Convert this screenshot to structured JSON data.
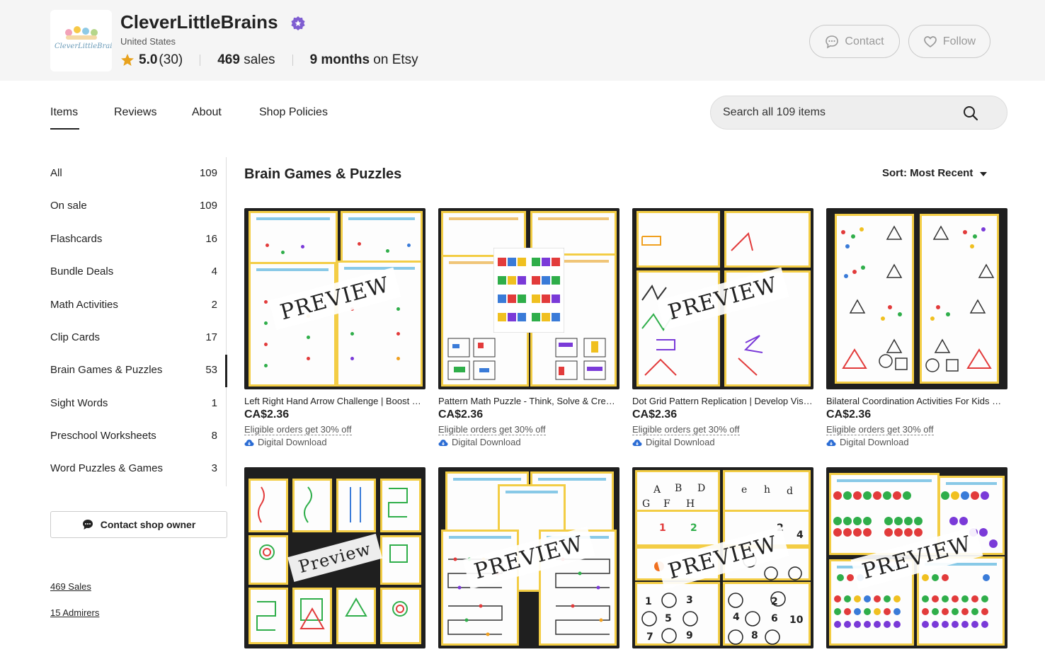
{
  "shop": {
    "name": "CleverLittleBrains",
    "logo_text": "CleverLittleBrains",
    "location": "United States",
    "rating": "5.0",
    "review_count": "(30)",
    "sales_number": "469",
    "sales_word": "sales",
    "age_number": "9 months",
    "age_suffix": "on Etsy",
    "contact_label": "Contact",
    "follow_label": "Follow"
  },
  "tabs": [
    {
      "label": "Items",
      "active": true
    },
    {
      "label": "Reviews"
    },
    {
      "label": "About"
    },
    {
      "label": "Shop Policies"
    }
  ],
  "search": {
    "placeholder": "Search all 109 items"
  },
  "sidebar": {
    "categories": [
      {
        "label": "All",
        "count": "109"
      },
      {
        "label": "On sale",
        "count": "109"
      },
      {
        "label": "Flashcards",
        "count": "16"
      },
      {
        "label": "Bundle Deals",
        "count": "4"
      },
      {
        "label": "Math Activities",
        "count": "2"
      },
      {
        "label": "Clip Cards",
        "count": "17"
      },
      {
        "label": "Brain Games & Puzzles",
        "count": "53",
        "active": true
      },
      {
        "label": "Sight Words",
        "count": "1"
      },
      {
        "label": "Preschool Worksheets",
        "count": "8"
      },
      {
        "label": "Word Puzzles & Games",
        "count": "3"
      }
    ],
    "contact_owner_label": "Contact shop owner",
    "sales_link": "469 Sales",
    "admirers_link": "15 Admirers"
  },
  "main": {
    "section_title": "Brain Games & Puzzles",
    "sort_label": "Sort: Most Recent",
    "listings": [
      {
        "title": "Left Right Hand Arrow Challenge | Boost Bilateral Coordination",
        "price": "CA$2.36",
        "promo": "Eligible orders get 30% off",
        "delivery": "Digital Download",
        "stamp": "PREVIEW"
      },
      {
        "title": "Pattern Math Puzzle - Think, Solve & Create Patterns",
        "price": "CA$2.36",
        "promo": "Eligible orders get 30% off",
        "delivery": "Digital Download",
        "stamp": ""
      },
      {
        "title": "Dot Grid Pattern Replication | Develop Visual Skills",
        "price": "CA$2.36",
        "promo": "Eligible orders get 30% off",
        "delivery": "Digital Download",
        "stamp": "PREVIEW"
      },
      {
        "title": "Bilateral Coordination Activities For Kids Worksheets",
        "price": "CA$2.36",
        "promo": "Eligible orders get 30% off",
        "delivery": "Digital Download",
        "stamp": ""
      },
      {
        "stamp": "Preview"
      },
      {
        "stamp": "PREVIEW"
      },
      {
        "stamp": "PREVIEW"
      },
      {
        "stamp": "PREVIEW"
      }
    ]
  },
  "colors": {
    "accent_purple": "#7f5dd1",
    "star": "#e8a21d",
    "sheet_border": "#f3cd45",
    "thumb_bg": "#1f1f1f",
    "download_icon": "#2b6cd4"
  }
}
